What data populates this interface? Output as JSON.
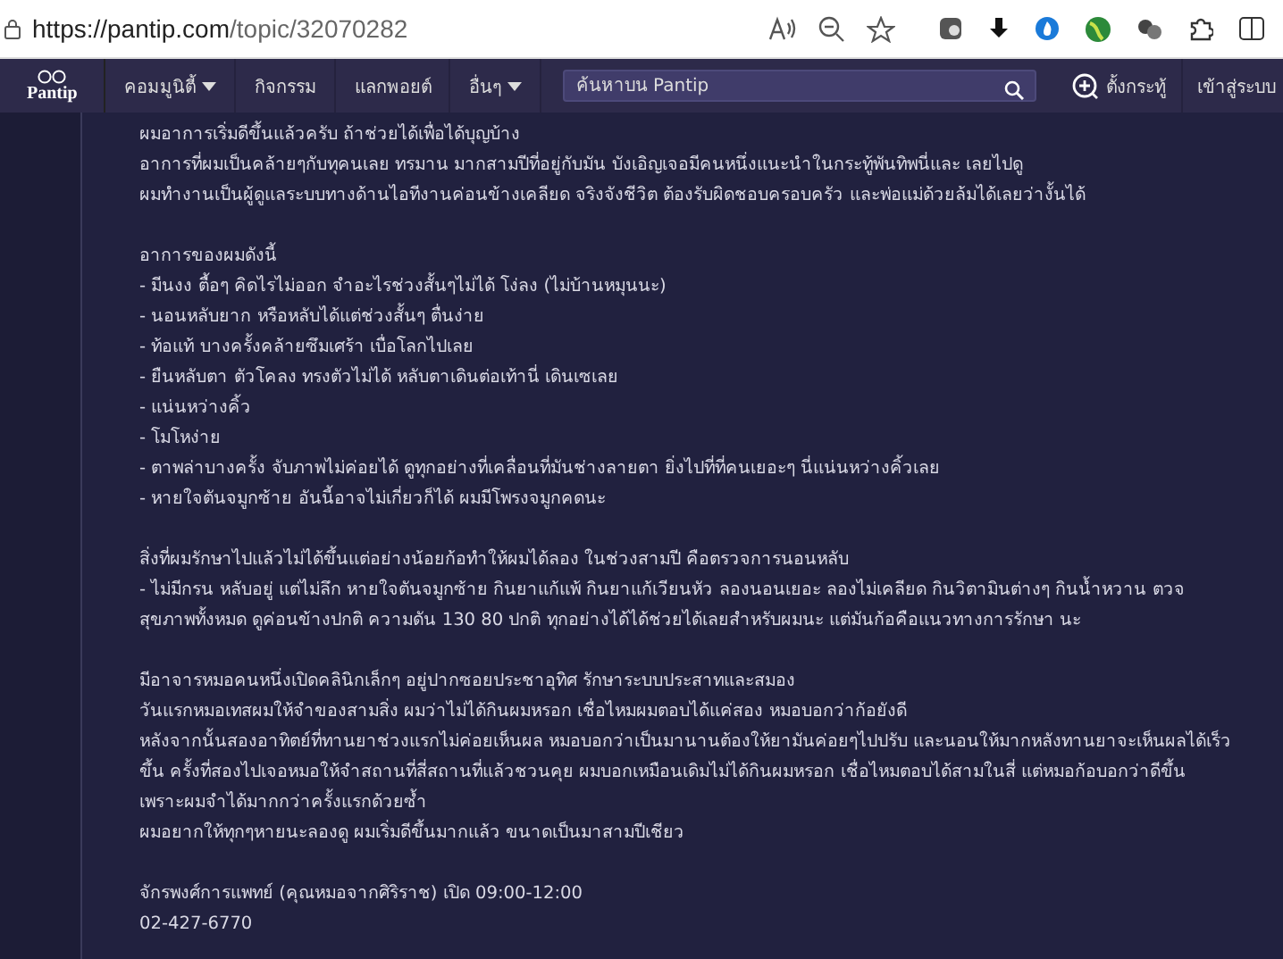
{
  "browser": {
    "url_host": "https://pantip.com",
    "url_path": "/topic/32070282"
  },
  "nav": {
    "logo": "Pantip",
    "items": [
      {
        "label": "คอมมูนิตี้",
        "dropdown": true
      },
      {
        "label": "กิจกรรม",
        "dropdown": false
      },
      {
        "label": "แลกพอยต์",
        "dropdown": false
      },
      {
        "label": "อื่นๆ",
        "dropdown": true
      }
    ],
    "search": {
      "placeholder": "ค้นหาบน Pantip"
    },
    "new_topic": "ตั้งกระทู้",
    "login": "เข้าสู่ระบบ"
  },
  "post": {
    "paragraphs": [
      [
        "ผมอาการเริ่มดีขึ้นแล้วครับ ถ้าช่วยได้เพื่อได้บุญบ้าง",
        "อาการที่ผมเป็นคล้ายๆกับทุคนเลย ทรมาน มากสามปีที่อยู่กับมัน  บังเอิญเจอมีคนหนึ่งแนะนำในกระทู้พันทิพนี่และ เลยไปดู",
        "ผมทำงานเป็นผู้ดูแลระบบทางด้านไอทีงานค่อนข้างเคลียด จริงจังชีวิต ต้องรับผิดชอบครอบครัว และพ่อแม่ด้วยล้มได้เลยว่างั้นได้"
      ],
      [
        "อาการของผมดังนี้",
        "- มีนงง ตื้อๆ คิดไรไม่ออก  จำอะไรช่วงสั้นๆไม่ได้ โง่ลง  (ไม่บ้านหมุนนะ)",
        "- นอนหลับยาก หรือหลับได้แต่ช่วงสั้นๆ ตื่นง่าย",
        "- ท้อแท้  บางครั้งคล้ายซึมเศร้า เบื่อโลกไปเลย",
        "- ยืนหลับตา ตัวโคลง ทรงตัวไม่ได้ หลับตาเดินต่อเท้านี่  เดินเซเลย",
        "- แน่นหว่างคิ้ว",
        "- โมโหง่าย",
        "- ตาพล่าบางครั้ง จับภาพไม่ค่อยได้ ดูทุกอย่างที่เคลื่อนที่มันช่างลายตา ยิ่งไปที่ที่คนเยอะๆ นี่แน่นหว่างคิ้วเลย",
        "- หายใจตันจมูกซ้าย  อันนี้อาจไม่เกี่ยวก็ได้ ผมมีโพรงจมูกคดนะ"
      ],
      [
        "สิ่งที่ผมรักษาไปแล้วไม่ได้ขึ้นแต่อย่างน้อยก้อทำให้ผมได้ลอง ในช่วงสามปี คือตรวจการนอนหลับ",
        "- ไม่มีกรน หลับอยู่ แต่ไม่ลึก  หายใจตันจมูกซ้าย กินยาแก้แพ้ กินยาแก้เวียนหัว  ลองนอนเยอะ ลองไม่เคลียด กินวิตามินต่างๆ  กินน้ำหวาน  ตวจ",
        "สุขภาพทั้งหมด ดูค่อนข้างปกติ  ความดัน  130 80 ปกติ  ทุกอย่างได้ได้ช่วยได้เลยสำหรับผมนะ  แต่มันก้อคือแนวทางการรักษา นะ"
      ],
      [
        "มีอาจารหมอคนหนึ่งเปิดคลินิกเล็กๆ อยู่ปากซอยประชาอุทิศ  รักษาระบบประสาทและสมอง",
        "วันแรกหมอเทสผมให้จำของสามสิ่ง  ผมว่าไม่ได้กินผมหรอก  เชื่อไหมผมตอบได้แค่สอง  หมอบอกว่าก้อยังดี",
        "หลังจากนั้นสองอาทิตย์ที่ทานยาช่วงแรกไม่ค่อยเห็นผล  หมอบอกว่าเป็นมานานต้องให้ยามันค่อยๆไปปรับ  และนอนให้มากหลังทานยาจะเห็นผลได้เร็ว",
        "ขึ้น  ครั้งที่สองไปเจอหมอให้จำสถานที่สี่สถานที่แล้วชวนคุย  ผมบอกเหมือนเดิมไม่ได้กินผมหรอก  เชื่อไหมตอบได้สามในสี่   แต่หมอก้อบอกว่าดีขึ้น",
        "เพราะผมจำได้มากกว่าครั้งแรกด้วยซ้ำ",
        "ผมอยากให้ทุกๆหายนะลองดู  ผมเริ่มดีขึ้นมากแล้ว ขนาดเป็นมาสามปีเชียว"
      ],
      [
        "จักรพงศ์การแพทย์  (คุณหมอจากศิริราช)  เปิด 09:00-12:00",
        "02-427-6770"
      ]
    ]
  }
}
